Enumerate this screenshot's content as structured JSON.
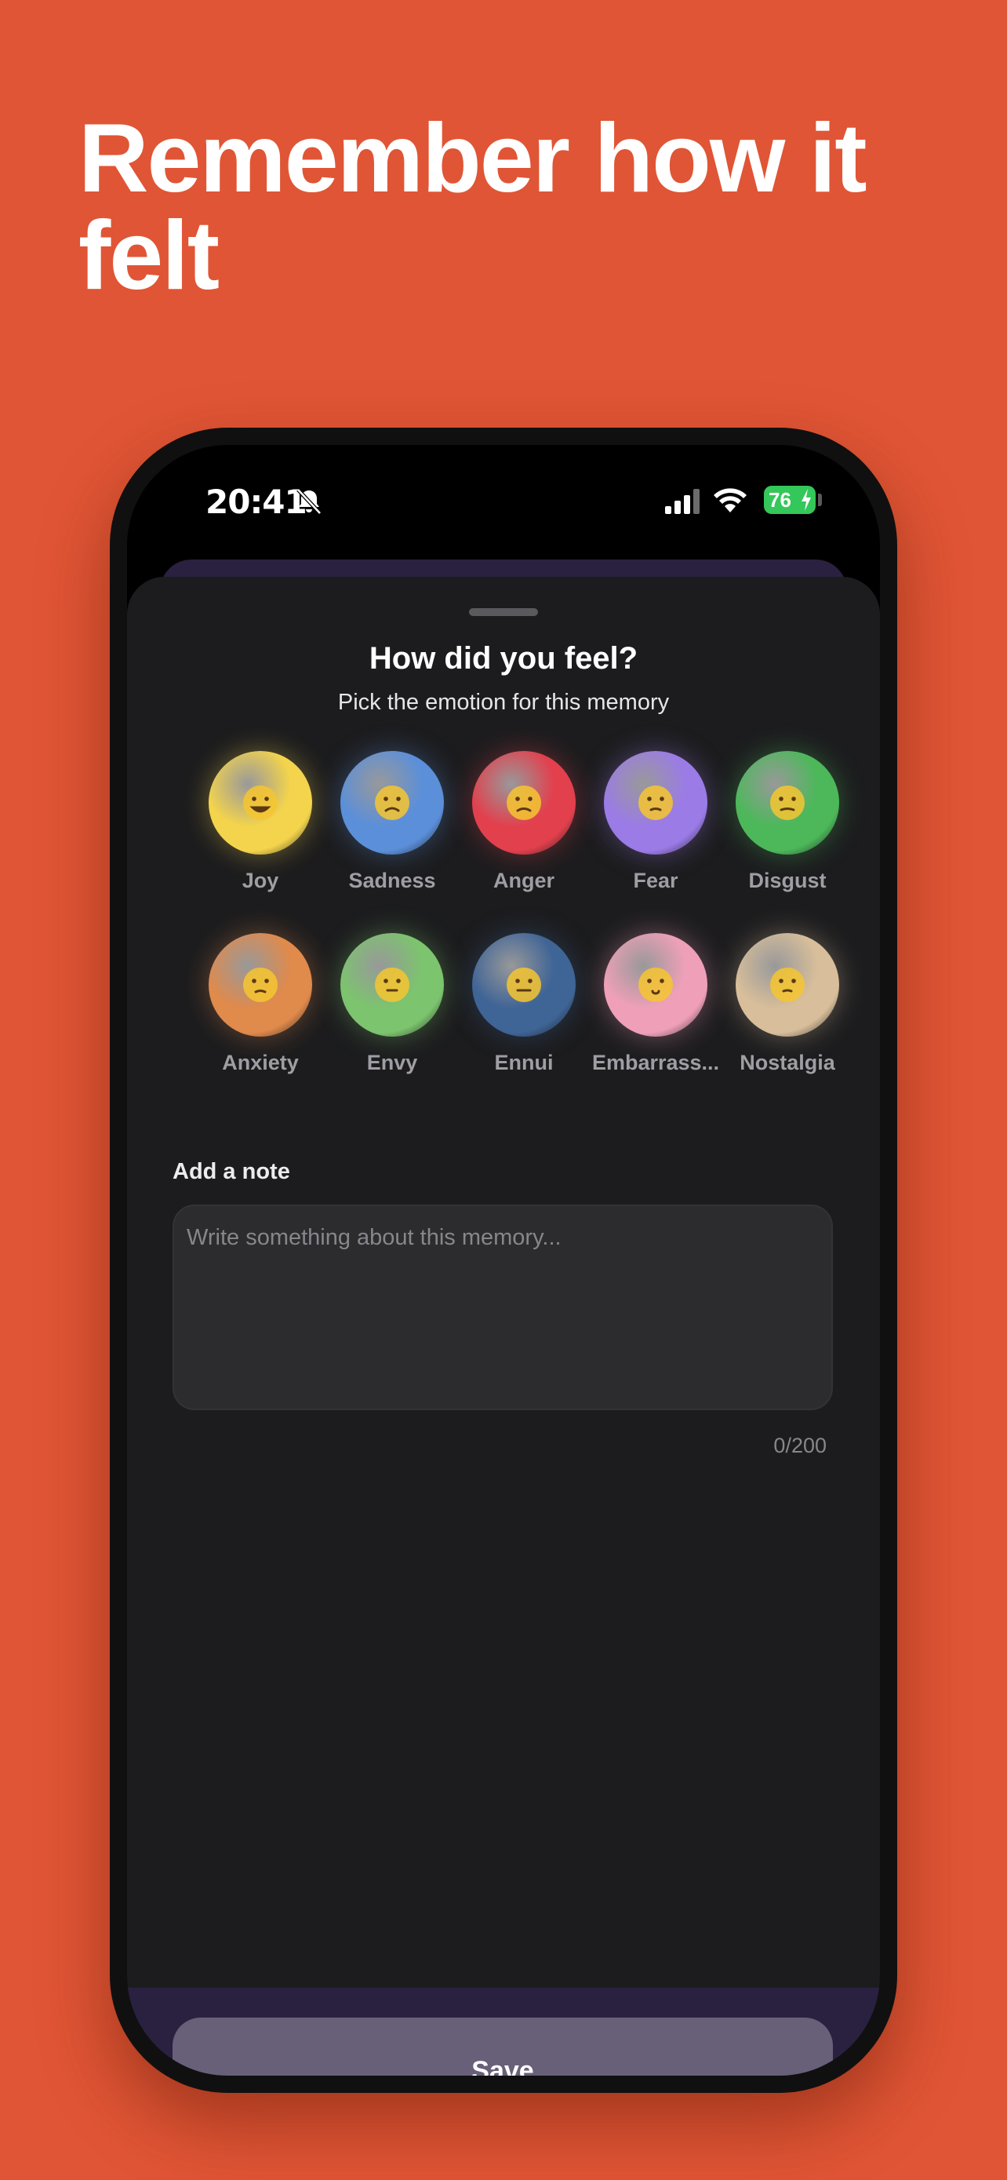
{
  "headline": "Remember how it felt",
  "status_bar": {
    "time": "20:41",
    "battery": "76"
  },
  "sheet": {
    "title": "How did you feel?",
    "subtitle": "Pick the emotion for this memory"
  },
  "emotions": [
    {
      "label": "Joy",
      "color": "#F4D44C"
    },
    {
      "label": "Sadness",
      "color": "#5B8FD9"
    },
    {
      "label": "Anger",
      "color": "#E2404D"
    },
    {
      "label": "Fear",
      "color": "#9B7BE6"
    },
    {
      "label": "Disgust",
      "color": "#4CB85A"
    },
    {
      "label": "Anxiety",
      "color": "#E08A4C"
    },
    {
      "label": "Envy",
      "color": "#7CC46E"
    },
    {
      "label": "Ennui",
      "color": "#3F6496"
    },
    {
      "label": "Embarrass...",
      "color": "#EFA0B8"
    },
    {
      "label": "Nostalgia",
      "color": "#D8BE9A"
    }
  ],
  "note": {
    "label": "Add a note",
    "placeholder": "Write something about this memory...",
    "value": "",
    "counter": "0/200"
  },
  "save_button": {
    "label": "Save"
  },
  "colors": {
    "background": "#E05535",
    "sheet": "#1C1C1E",
    "footer": "#2A2140",
    "save_button": "#686079",
    "battery": "#34C759"
  }
}
